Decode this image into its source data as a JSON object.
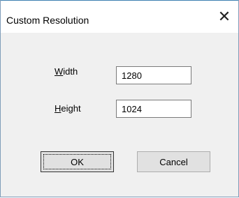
{
  "window": {
    "title": "Custom Resolution",
    "close_glyph": "✕"
  },
  "form": {
    "width_label_accel": "W",
    "width_label_rest": "idth",
    "width_value": "1280",
    "height_label_accel": "H",
    "height_label_rest": "eight",
    "height_value": "1024"
  },
  "buttons": {
    "ok_label": "OK",
    "cancel_label": "Cancel"
  }
}
